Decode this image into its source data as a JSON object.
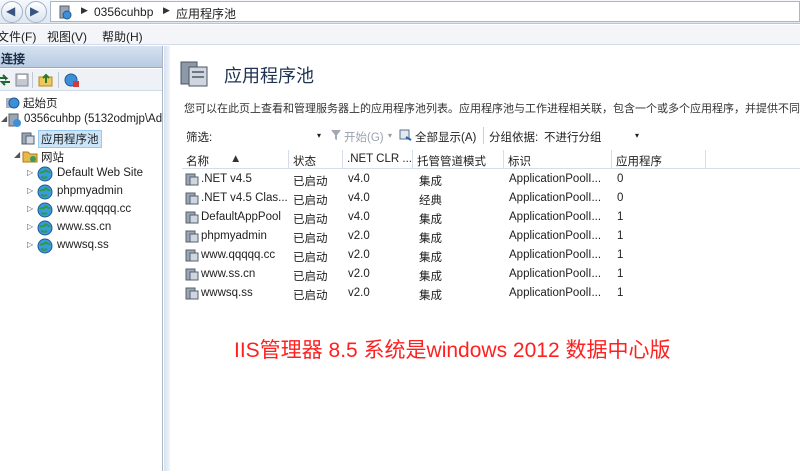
{
  "address_bar": {
    "segments": [
      "0356cuhbp",
      "应用程序池"
    ]
  },
  "menu": {
    "items": [
      "文件(F)",
      "视图(V)",
      "帮助(H)"
    ]
  },
  "connections": {
    "header": "连接",
    "tree": [
      {
        "label": "起始页",
        "icon": "start-page-icon"
      },
      {
        "label": "0356cuhbp (5132odmjp\\Ad",
        "icon": "server-icon"
      },
      {
        "label": "应用程序池",
        "icon": "app-pool-icon",
        "selected": true
      },
      {
        "label": "网站",
        "icon": "sites-folder-icon"
      },
      {
        "label": "Default Web Site",
        "icon": "globe-icon"
      },
      {
        "label": "phpmyadmin",
        "icon": "globe-icon"
      },
      {
        "label": "www.qqqqq.cc",
        "icon": "globe-icon"
      },
      {
        "label": "www.ss.cn",
        "icon": "globe-icon"
      },
      {
        "label": "wwwsq.ss",
        "icon": "globe-icon"
      }
    ]
  },
  "main": {
    "title": "应用程序池",
    "description": "您可以在此页上查看和管理服务器上的应用程序池列表。应用程序池与工作进程相关联，包含一个或多个应用程序，并提供不同应",
    "filter": {
      "label": "筛选:",
      "go_label": "开始(G)",
      "show_all_label": "全部显示(A)",
      "group_label": "分组依据:",
      "group_value": "不进行分组"
    },
    "columns": [
      "名称",
      "状态",
      ".NET CLR ...",
      "托管管道模式",
      "标识",
      "应用程序"
    ],
    "rows": [
      {
        "name": ".NET v4.5",
        "status": "已启动",
        "clr": "v4.0",
        "pipeline": "集成",
        "identity": "ApplicationPoolI...",
        "apps": "0"
      },
      {
        "name": ".NET v4.5 Clas...",
        "status": "已启动",
        "clr": "v4.0",
        "pipeline": "经典",
        "identity": "ApplicationPoolI...",
        "apps": "0"
      },
      {
        "name": "DefaultAppPool",
        "status": "已启动",
        "clr": "v4.0",
        "pipeline": "集成",
        "identity": "ApplicationPoolI...",
        "apps": "1"
      },
      {
        "name": "phpmyadmin",
        "status": "已启动",
        "clr": "v2.0",
        "pipeline": "集成",
        "identity": "ApplicationPoolI...",
        "apps": "1"
      },
      {
        "name": "www.qqqqq.cc",
        "status": "已启动",
        "clr": "v2.0",
        "pipeline": "集成",
        "identity": "ApplicationPoolI...",
        "apps": "1"
      },
      {
        "name": "www.ss.cn",
        "status": "已启动",
        "clr": "v2.0",
        "pipeline": "集成",
        "identity": "ApplicationPoolI...",
        "apps": "1"
      },
      {
        "name": "wwwsq.ss",
        "status": "已启动",
        "clr": "v2.0",
        "pipeline": "集成",
        "identity": "ApplicationPoolI...",
        "apps": "1"
      }
    ]
  },
  "overlay_caption": "IIS管理器 8.5 系统是windows 2012 数据中心版",
  "colors": {
    "caption_red": "#ff2020",
    "selection_blue": "#cce4f7",
    "header_blue": "#b8cbe2"
  }
}
